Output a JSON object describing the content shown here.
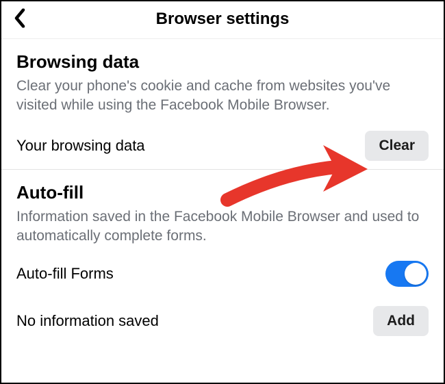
{
  "header": {
    "title": "Browser settings"
  },
  "browsing": {
    "title": "Browsing data",
    "description": "Clear your phone's cookie and cache from websites you've visited while using the Facebook Mobile Browser.",
    "row_label": "Your browsing data",
    "clear_label": "Clear"
  },
  "autofill": {
    "title": "Auto-fill",
    "description": "Information saved in the Facebook Mobile Browser and used to automatically complete forms.",
    "forms_label": "Auto-fill Forms",
    "forms_enabled": true,
    "empty_label": "No information saved",
    "add_label": "Add"
  },
  "colors": {
    "toggle_on": "#1778f2",
    "arrow": "#e7362b"
  }
}
